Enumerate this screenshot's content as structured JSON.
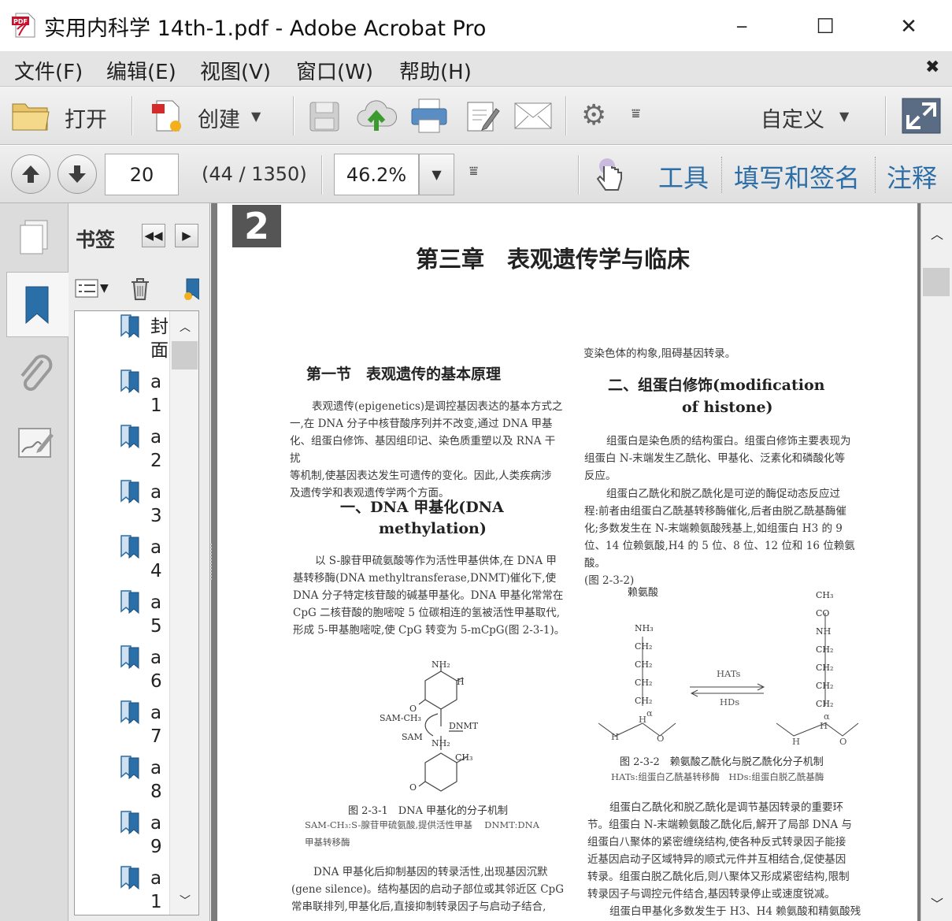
{
  "window": {
    "title": "实用内科学 14th-1.pdf - Adobe Acrobat Pro",
    "controls": {
      "minimize": "─",
      "maximize": "☐",
      "close": "✕"
    }
  },
  "menubar": {
    "items": [
      "文件(F)",
      "编辑(E)",
      "视图(V)",
      "窗口(W)",
      "帮助(H)"
    ],
    "close_glyph": "✖"
  },
  "toolbar": {
    "open_label": "打开",
    "create_label": "创建",
    "customize_label": "自定义",
    "icons": [
      "folder-icon",
      "create-pdf-icon",
      "save-icon",
      "cloud-upload-icon",
      "print-icon",
      "edit-icon",
      "mail-icon",
      "gear-icon",
      "expand-icon"
    ]
  },
  "navbar": {
    "page_value": "20",
    "page_count": "(44 / 1350)",
    "zoom_value": "46.2%",
    "tabs": [
      "工具",
      "填写和签名",
      "注释"
    ]
  },
  "bookmarks": {
    "title": "书签",
    "items": [
      {
        "line1": "封",
        "line2": "面"
      },
      {
        "line1": "a",
        "line2": "1"
      },
      {
        "line1": "a",
        "line2": "2"
      },
      {
        "line1": "a",
        "line2": "3"
      },
      {
        "line1": "a",
        "line2": "4"
      },
      {
        "line1": "a",
        "line2": "5"
      },
      {
        "line1": "a",
        "line2": "6"
      },
      {
        "line1": "a",
        "line2": "7"
      },
      {
        "line1": "a",
        "line2": "8"
      },
      {
        "line1": "a",
        "line2": "9"
      },
      {
        "line1": "a",
        "line2": "1"
      }
    ]
  },
  "document": {
    "chapter_tab": "2",
    "chapter_title": "第三章　表观遗传学与临床",
    "section_title": "第一节　表观遗传的基本原理",
    "intro": [
      "表观遗传(epigenetics)是调控基因表达的基本方式之",
      "一,在 DNA 分子中核苷酸序列并不改变,通过 DNA 甲基",
      "化、组蛋白修饰、基因组印记、染色质重塑以及 RNA 干扰",
      "等机制,使基因表达发生可遗传的变化。因此,人类疾病涉",
      "及遗传学和表观遗传学两个方面。"
    ],
    "sub1_title_1": "一、DNA 甲基化(DNA",
    "sub1_title_2": "methylation)",
    "sub1_para": [
      "以 S-腺苷甲硫氨酸等作为活性甲基供体,在 DNA 甲",
      "基转移酶(DNA methyltransferase,DNMT)催化下,使",
      "DNA 分子特定核苷酸的碱基甲基化。DNA 甲基化常常在",
      "CpG 二核苷酸的胞嘧啶 5 位碳相连的氢被活性甲基取代,",
      "形成 5-甲基胞嘧啶,使 CpG 转变为 5-mCpG(图 2-3-1)。"
    ],
    "fig1": {
      "labels": [
        "NH₂",
        "H",
        "O",
        "SAM-CH₃",
        "DNMT",
        "SAM",
        "NH₂",
        "CH₃",
        "O"
      ],
      "caption": "图 2-3-1　DNA 甲基化的分子机制",
      "note_1": "SAM-CH₃:S-腺苷甲硫氨酸,提供活性甲基　 DNMT:DNA",
      "note_2": "甲基转移酶"
    },
    "left_bottom": [
      "DNA 甲基化后抑制基因的转录活性,出现基因沉默",
      "(gene silence)。结构基因的启动子部位或其邻近区 CpG",
      "常串联排列,甲基化后,直接抑制转录因子与启动子结合,"
    ],
    "right_top": "变染色体的构象,阻碍基因转录。",
    "sub2_title_1": "二、组蛋白修饰(modification",
    "sub2_title_2": "of histone)",
    "sub2_para1": [
      "组蛋白是染色质的结构蛋白。组蛋白修饰主要表现为",
      "组蛋白 N-末端发生乙酰化、甲基化、泛素化和磷酸化等",
      "反应。"
    ],
    "sub2_para2": [
      "组蛋白乙酰化和脱乙酰化是可逆的酶促动态反应过",
      "程:前者由组蛋白乙酰基转移酶催化,后者由脱乙酰基酶催",
      "化;多数发生在 N-末端赖氨酸残基上,如组蛋白 H3 的 9",
      "位、14 位赖氨酸,H4 的 5 位、8 位、12 位和 16 位赖氨酸。",
      "(图 2-3-2)"
    ],
    "fig2": {
      "lysine_label": "赖氨酸",
      "left_chain": [
        "NH₃",
        "CH₂",
        "CH₂",
        "CH₂",
        "CH₂"
      ],
      "right_chain": [
        "CH₃",
        "CO",
        "NH",
        "CH₂",
        "CH₂",
        "CH₂",
        "CH₂"
      ],
      "hats": "HATs",
      "hds": "HDs",
      "alpha": "α",
      "h": "H",
      "n": "N",
      "c": "C",
      "o": "O",
      "caption": "图 2-3-2　赖氨酸乙酰化与脱乙酰化分子机制",
      "note": "HATs:组蛋白乙酰基转移酶　HDs:组蛋白脱乙酰基酶"
    },
    "right_bottom": [
      "组蛋白乙酰化和脱乙酰化是调节基因转录的重要环",
      "节。组蛋白 N-末端赖氨酸乙酰化后,解开了局部 DNA 与",
      "组蛋白八聚体的紧密缠绕结构,使各种反式转录因子能接",
      "近基因启动子区域特异的顺式元件并互相结合,促使基因",
      "转录。组蛋白脱乙酰化后,则八聚体又形成紧密结构,限制",
      "转录因子与调控元件结合,基因转录停止或速度锐减。",
      "组蛋白甲基化多数发生于 H3、H4 赖氨酸和精氨酸残"
    ]
  }
}
